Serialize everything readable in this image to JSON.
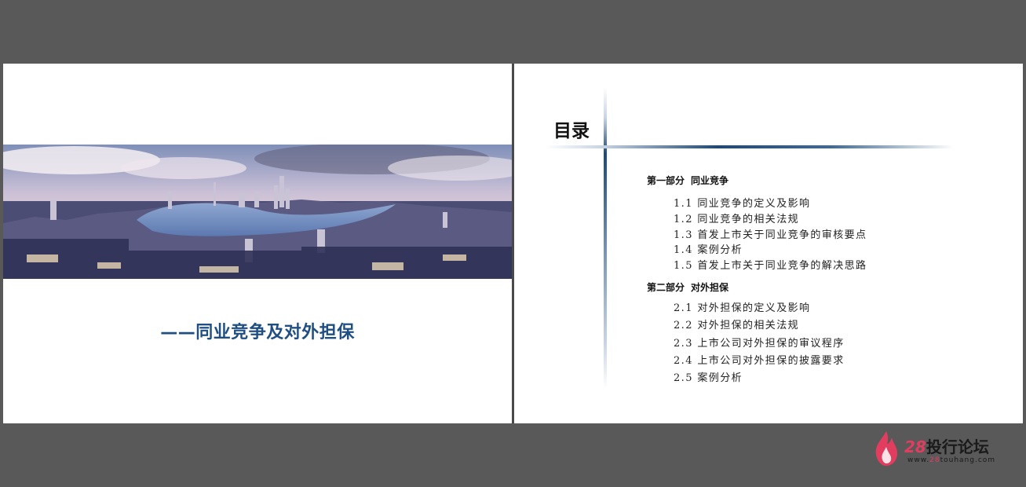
{
  "cover": {
    "subtitle": "——同业竞争及对外担保"
  },
  "toc": {
    "title": "目录",
    "parts": [
      {
        "label": "第一部分",
        "name": "同业竞争",
        "items": [
          "1.1 同业竞争的定义及影响",
          "1.2 同业竞争的相关法规",
          "1.3 首发上市关于同业竞争的审核要点",
          "1.4 案例分析",
          "1.5 首发上市关于同业竞争的解决思路"
        ]
      },
      {
        "label": "第二部分",
        "name": "对外担保",
        "items": [
          "2.1 对外担保的定义及影响",
          "2.2 对外担保的相关法规",
          "2.3 上市公司对外担保的审议程序",
          "2.4 上市公司对外担保的披露要求",
          "2.5 案例分析"
        ]
      }
    ]
  },
  "watermark": {
    "number": "28",
    "name": "投行论坛",
    "url_prefix": "www.",
    "url_accent": "28",
    "url_suffix": "touhang.com"
  },
  "colors": {
    "subtitle": "#1f4e83",
    "logo_accent": "#e23d5e",
    "background": "#595959"
  }
}
